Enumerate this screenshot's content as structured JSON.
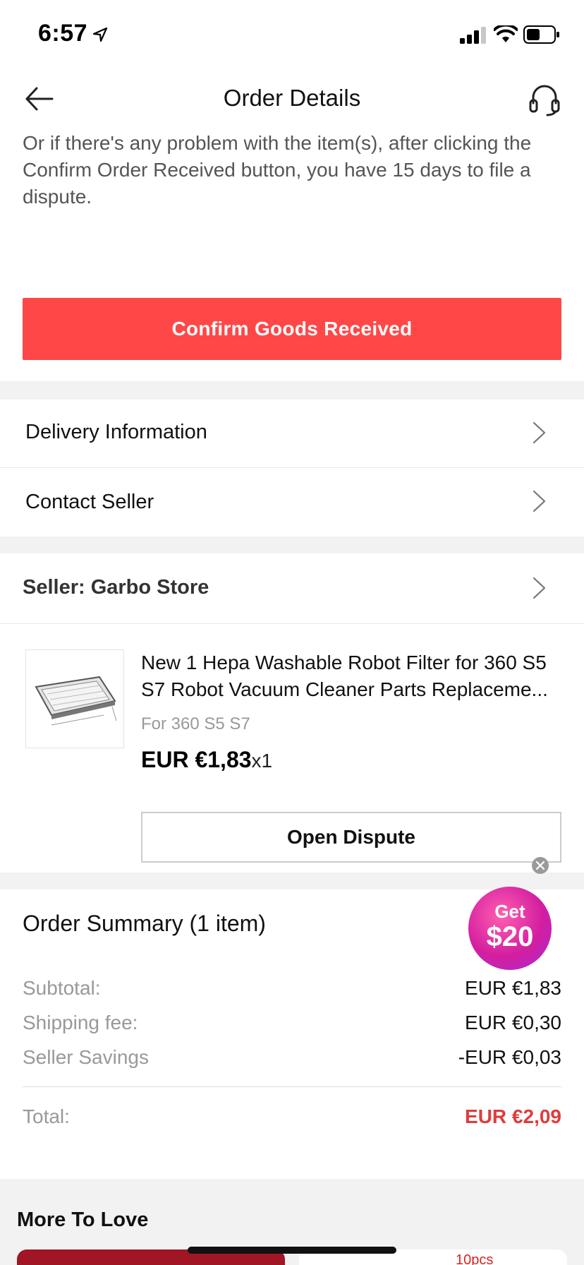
{
  "status_bar": {
    "time": "6:57"
  },
  "nav": {
    "title": "Order Details"
  },
  "info_text": "Or if there's any problem with the item(s), after clicking the Confirm Order Received button, you have 15 days to file a dispute.",
  "confirm_button": "Confirm Goods Received",
  "rows": {
    "delivery": "Delivery Information",
    "contact": "Contact Seller"
  },
  "seller": {
    "label": "Seller: Garbo Store"
  },
  "product": {
    "title": "New 1 Hepa Washable Robot Filter for 360 S5 S7 Robot Vacuum Cleaner Parts Replaceme...",
    "variant": "For 360 S5 S7",
    "price": "EUR €1,83",
    "quantity": "x1",
    "dispute_button": "Open Dispute"
  },
  "promo": {
    "get": "Get",
    "amount": "$20"
  },
  "summary": {
    "title": "Order Summary (1 item)",
    "subtotal_label": "Subtotal:",
    "subtotal_value": "EUR €1,83",
    "shipping_label": "Shipping fee:",
    "shipping_value": "EUR €0,30",
    "savings_label": "Seller Savings",
    "savings_value": "-EUR €0,03",
    "total_label": "Total:",
    "total_value": "EUR €2,09"
  },
  "more": {
    "title": "More To Love",
    "card_right_text": "10pcs"
  },
  "colors": {
    "accent": "#ff4747",
    "total": "#e03c3c",
    "promo": "#d41ea0"
  }
}
